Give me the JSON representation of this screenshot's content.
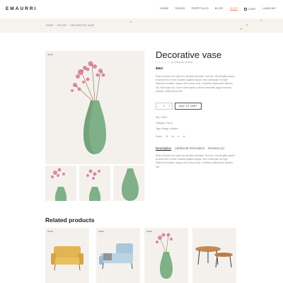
{
  "header": {
    "logo": "EMAURRI",
    "nav": [
      "HOME",
      "PAGES",
      "PORTFOLIO",
      "BLOG",
      "SHOP",
      "LANDING"
    ],
    "active_nav": "SHOP",
    "cart_label": "CART"
  },
  "breadcrumb": [
    "HOME",
    "DECOR",
    "DECORATIVE VASE"
  ],
  "product": {
    "sale_badge": "SALE",
    "title": "Decorative vase",
    "rating_text": "(1 customer review)",
    "price": "$503",
    "description": "Etiam sit amet orci eget eros faucibus tincidunt. Duis leo. Sed fringilla mauris sit amet nibh. Donec sodales sagittis magna. Sed consequat, leo eget bibendum sodales, augue velit cursus nunc. Curabitur ullamcorper ultricies nisi. Nam eget dui. Donec vitae sapien ut libero venenatis augue faucibus pulvinar. Nullam quis ante.",
    "qty_minus": "-",
    "qty_value": "1",
    "qty_plus": "+",
    "add_to_cart": "ADD TO CART",
    "sku": "SKU: 3003",
    "category": "Category: Decor",
    "tags": "Tags: Design, Modern",
    "share_label": "Share:",
    "share_icons": [
      "fb",
      "tw",
      "in",
      "vk"
    ]
  },
  "tabs": {
    "items": [
      "Description",
      "Additional information",
      "Reviews (1)"
    ],
    "active": "Description",
    "content": "Etiam sit amet orci eget eros faucibus tincidunt. Duis leo. Sed fringilla mauris sit amet nibh. Donec sodales sagittis magna. Sed consequat, leo eget bibendum sodales, augue velit cursus nunc. Curabitur ullamcorper ultricies nisi."
  },
  "related": {
    "title": "Related products",
    "items": [
      {
        "badge": "SALE",
        "icon": "armchair"
      },
      {
        "badge": "SALE",
        "icon": "sofa"
      },
      {
        "badge": "SALE",
        "icon": "vase"
      },
      {
        "badge": "",
        "icon": "coffee-tables"
      }
    ]
  },
  "colors": {
    "accent": "#e07a5f",
    "vase_green": "#7fb088",
    "flower_pink": "#d88aa0",
    "mustard": "#e0b552",
    "light_blue": "#a9c7db",
    "wood": "#c48a52"
  }
}
